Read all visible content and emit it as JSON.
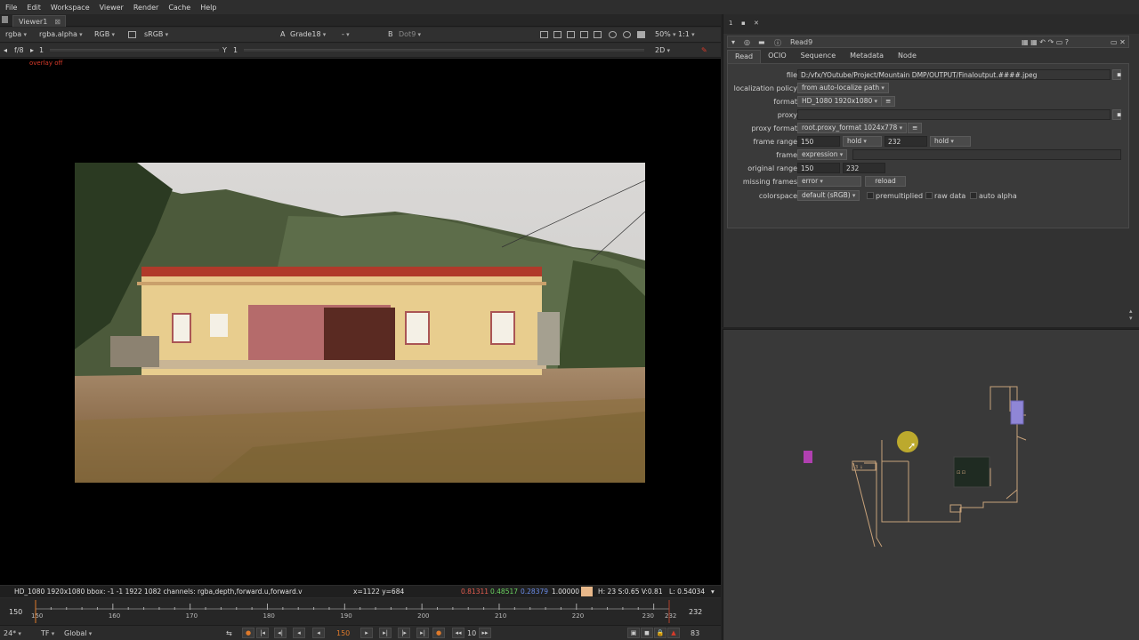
{
  "menubar": {
    "items": [
      "File",
      "Edit",
      "Workspace",
      "Viewer",
      "Render",
      "Cache",
      "Help"
    ]
  },
  "viewer": {
    "tab_label": "Viewer1",
    "tab_close": "⊠",
    "toolbar1": {
      "channels": "rgba",
      "alpha_channel": "rgba.alpha",
      "display_channel": "RGB",
      "colorspace": "sRGB",
      "input_a_label": "A",
      "input_a": "Grade18",
      "input_wipe": "-",
      "input_b_label": "B",
      "input_b": "Dot9",
      "zoom": "50%",
      "ratio": "1:1"
    },
    "toolbar2": {
      "fstop": "f/8",
      "gain": "1",
      "gamma_label": "Y",
      "gamma": "1",
      "view_mode": "2D"
    },
    "overlay_text": "overlay off",
    "info": {
      "format": "HD_1080 1920x1080  bbox: -1 -1 1922 1082 channels: rgba,depth,forward.u,forward.v",
      "coords": "x=1122 y=684",
      "r": "0.81311",
      "g": "0.48517",
      "b": "0.28379",
      "a": "1.00000",
      "hsv": "H: 23 S:0.65 V:0.81",
      "lum": "L: 0.54034",
      "swatch_color": "#e8b88a"
    },
    "timeline": {
      "start": "150",
      "end": "232",
      "ticks": [
        "150",
        "160",
        "170",
        "180",
        "190",
        "200",
        "210",
        "220",
        "230",
        "232"
      ],
      "playhead_label": "150"
    },
    "transport": {
      "fps": "24*",
      "tf": "TF",
      "scope": "Global",
      "current_frame": "150",
      "increment": "10",
      "frame_count": "83"
    }
  },
  "properties": {
    "header_tabs": [
      "1",
      "🔒",
      "✖"
    ],
    "node_name": "Read9",
    "tabs": [
      "Read",
      "OCIO",
      "Sequence",
      "Metadata",
      "Node"
    ],
    "active_tab": "Read",
    "fields": {
      "file_label": "file",
      "file_value": "D:/vfx/YOutube/Project/Mountain DMP/OUTPUT/Finaloutput.####.jpeg",
      "localization_label": "localization policy",
      "localization_value": "from auto-localize path",
      "format_label": "format",
      "format_value": "HD_1080 1920x1080",
      "proxy_label": "proxy",
      "proxy_value": "",
      "proxy_format_label": "proxy format",
      "proxy_format_value": "root.proxy_format 1024x778",
      "frame_range_label": "frame range",
      "frame_range_start": "150",
      "frame_range_before": "hold",
      "frame_range_end": "232",
      "frame_range_after": "hold",
      "frame_label": "frame",
      "frame_value": "expression",
      "original_range_label": "original range",
      "original_range_start": "150",
      "original_range_end": "232",
      "missing_frames_label": "missing frames",
      "missing_frames_value": "error",
      "reload_label": "reload",
      "colorspace_label": "colorspace",
      "colorspace_value": "default (sRGB)",
      "premultiplied_label": "premultiplied",
      "raw_data_label": "raw data",
      "auto_alpha_label": "auto alpha"
    }
  },
  "colors": {
    "node_lines": "#c8a27a",
    "accent_orange": "#e07a2a",
    "cursor_highlight": "#cbb62c",
    "node_purple": "#8f86d6",
    "node_magenta": "#b040b0"
  }
}
